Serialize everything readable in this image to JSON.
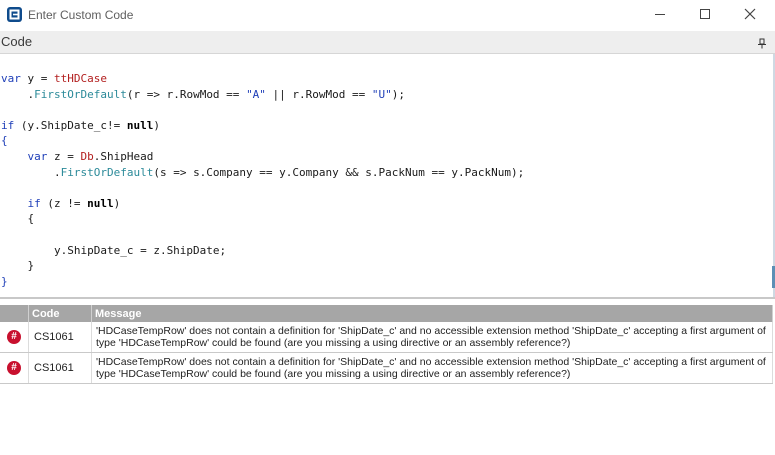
{
  "window": {
    "title": "Enter Custom Code"
  },
  "pane": {
    "title": "Code"
  },
  "code": {
    "lines": [
      "",
      "var y = ttHDCase",
      "    .FirstOrDefault(r => r.RowMod == \"A\" || r.RowMod == \"U\");",
      "",
      "if (y.ShipDate_c!= null)",
      "{",
      "    var z = Db.ShipHead",
      "        .FirstOrDefault(s => s.Company == y.Company && s.PackNum == y.PackNum);",
      "",
      "    if (z != null)",
      "    {",
      "",
      "        y.ShipDate_c = z.ShipDate;",
      "    }",
      "}"
    ]
  },
  "errors": {
    "columns": [
      "",
      "Code",
      "Message"
    ],
    "rows": [
      {
        "code": "CS1061",
        "message": "'HDCaseTempRow' does not contain a definition for 'ShipDate_c' and no accessible extension method 'ShipDate_c' accepting a first argument of type 'HDCaseTempRow' could be found (are you missing a using directive or an assembly reference?)"
      },
      {
        "code": "CS1061",
        "message": "'HDCaseTempRow' does not contain a definition for 'ShipDate_c' and no accessible extension method 'ShipDate_c' accepting a first argument of type 'HDCaseTempRow' could be found (are you missing a using directive or an assembly reference?)"
      }
    ]
  },
  "icons": {
    "app": "epicor-app-icon",
    "minimize": "minimize-icon",
    "maximize": "maximize-icon",
    "close": "close-icon",
    "pin": "pin-icon",
    "error": "error-icon"
  }
}
